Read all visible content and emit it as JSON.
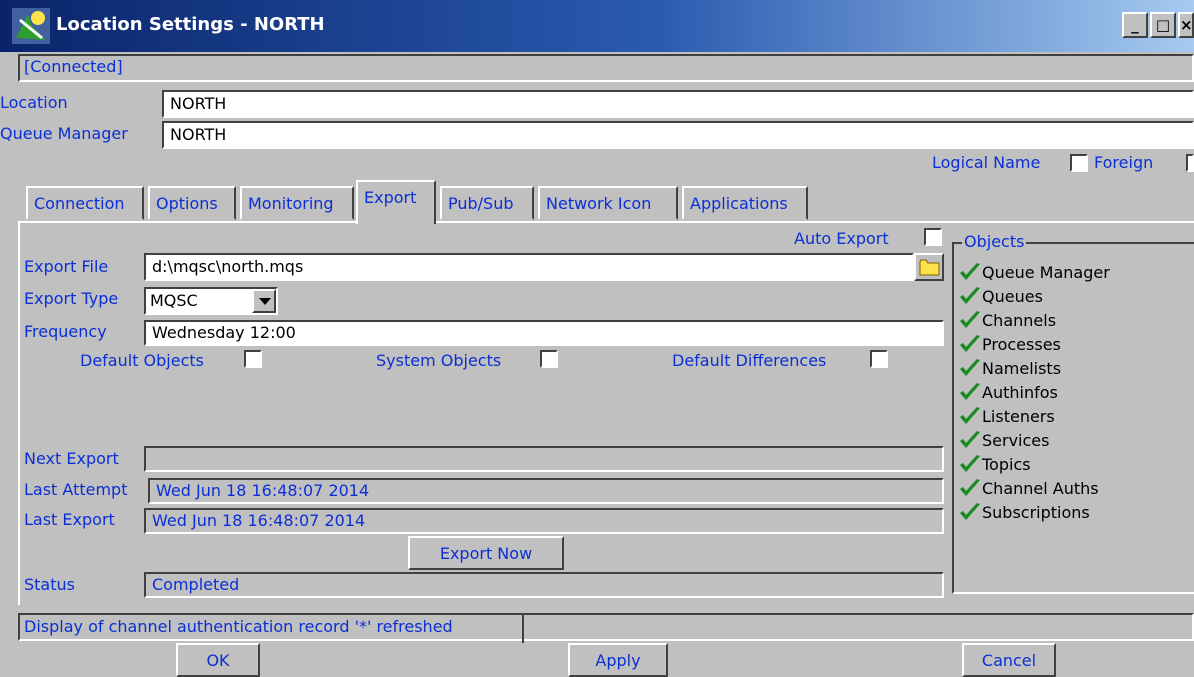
{
  "window": {
    "title": "Location Settings - NORTH",
    "minimize": "_",
    "maximize": "□",
    "close": "×"
  },
  "connection_status": "[Connected]",
  "location": {
    "label": "Location",
    "value": "NORTH"
  },
  "queue_manager": {
    "label": "Queue Manager",
    "value": "NORTH"
  },
  "logical_name_label": "Logical Name",
  "foreign_label": "Foreign",
  "tabs": [
    "Connection",
    "Options",
    "Monitoring",
    "Export",
    "Pub/Sub",
    "Network Icon",
    "Applications"
  ],
  "active_tab": "Export",
  "export": {
    "auto_export_label": "Auto Export",
    "export_file_label": "Export File",
    "export_file_value": "d:\\mqsc\\north.mqs",
    "export_type_label": "Export Type",
    "export_type_value": "MQSC",
    "frequency_label": "Frequency",
    "frequency_value": "Wednesday 12:00",
    "default_objects_label": "Default Objects",
    "system_objects_label": "System Objects",
    "default_differences_label": "Default Differences",
    "next_export_label": "Next Export",
    "next_export_value": "",
    "last_attempt_label": "Last Attempt",
    "last_attempt_value": "Wed Jun 18 16:48:07 2014",
    "last_export_label": "Last Export",
    "last_export_value": "Wed Jun 18 16:48:07 2014",
    "export_now_label": "Export Now",
    "status_label": "Status",
    "status_value": "Completed"
  },
  "objects": {
    "title": "Objects",
    "items": [
      "Queue Manager",
      "Queues",
      "Channels",
      "Processes",
      "Namelists",
      "Authinfos",
      "Listeners",
      "Services",
      "Topics",
      "Channel Auths",
      "Subscriptions"
    ],
    "check_color": "#1a8a1a"
  },
  "status_bar": "Display of channel authentication record '*' refreshed",
  "buttons": {
    "ok": "OK",
    "apply": "Apply",
    "cancel": "Cancel"
  }
}
